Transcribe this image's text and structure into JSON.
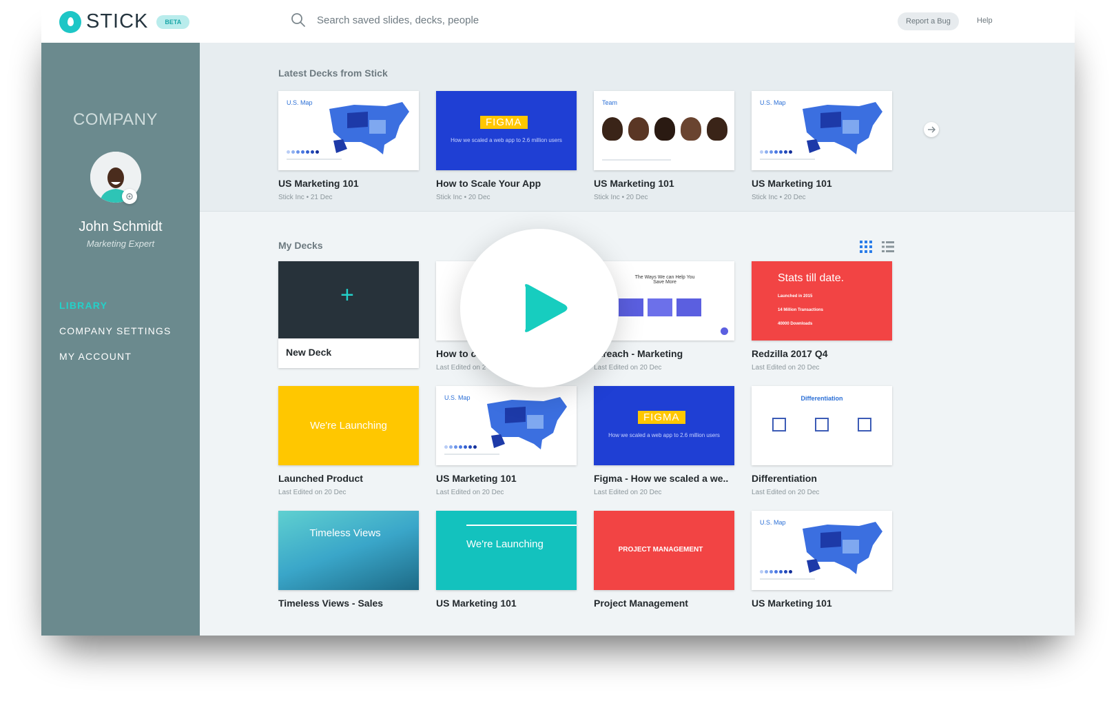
{
  "header": {
    "brand": "STICK",
    "beta": "BETA",
    "search_placeholder": "Search saved slides, decks, people",
    "report_bug": "Report a Bug",
    "help": "Help"
  },
  "sidebar": {
    "company": "COMPANY",
    "user_name": "John Schmidt",
    "user_role": "Marketing Expert",
    "nav": [
      {
        "label": "LIBRARY",
        "active": true
      },
      {
        "label": "COMPANY SETTINGS",
        "active": false
      },
      {
        "label": "MY ACCOUNT",
        "active": false
      }
    ]
  },
  "latest": {
    "title": "Latest Decks from Stick",
    "cards": [
      {
        "title": "US Marketing 101",
        "meta": "Stick Inc  •  21 Dec",
        "thumb": "map",
        "label": "U.S. Map"
      },
      {
        "title": "How to Scale Your App",
        "meta": "Stick Inc  •  20 Dec",
        "thumb": "figma",
        "label": "FIGMA",
        "caption": "How we scaled a web app to 2.6 million users"
      },
      {
        "title": "US Marketing 101",
        "meta": "Stick Inc  •  20 Dec",
        "thumb": "team",
        "label": "Team"
      },
      {
        "title": "US Marketing 101",
        "meta": "Stick Inc  •  20 Dec",
        "thumb": "map",
        "label": "U.S. Map"
      }
    ]
  },
  "my_decks": {
    "title": "My Decks",
    "new_deck": "New Deck",
    "cards": [
      {
        "title": "How to c",
        "meta": "Last Edited on 2",
        "thumb": "blank"
      },
      {
        "title": "utreach - Marketing",
        "meta": "Last Edited on 20 Dec",
        "thumb": "ways",
        "label": "The Ways We can Help You Save More"
      },
      {
        "title": "Redzilla 2017 Q4",
        "meta": "Last Edited on 20 Dec",
        "thumb": "stats",
        "label": "Stats till date.",
        "lines": [
          "Launched in 2015",
          "14 Million Transactions",
          "40000 Downloads"
        ]
      },
      {
        "title": "Launched Product",
        "meta": "Last Edited on 20 Dec",
        "thumb": "yellow",
        "label": "We're Launching"
      },
      {
        "title": "US Marketing 101",
        "meta": "Last Edited on 20 Dec",
        "thumb": "map",
        "label": "U.S. Map"
      },
      {
        "title": "Figma - How we scaled a we..",
        "meta": "Last Edited on 20 Dec",
        "thumb": "figma",
        "label": "FIGMA",
        "caption": "How we scaled a web app to 2.6 million users"
      },
      {
        "title": "Differentiation",
        "meta": "Last Edited on 20 Dec",
        "thumb": "diff",
        "label": "Differentiation"
      },
      {
        "title": "Timeless Views - Sales",
        "meta": "",
        "thumb": "timeless",
        "label": "Timeless Views"
      },
      {
        "title": "US Marketing 101",
        "meta": "",
        "thumb": "teal",
        "label": "We're Launching"
      },
      {
        "title": "Project Management",
        "meta": "",
        "thumb": "redpm",
        "label": "PROJECT MANAGEMENT"
      },
      {
        "title": "US Marketing 101",
        "meta": "",
        "thumb": "map",
        "label": "U.S. Map"
      }
    ]
  },
  "colors": {
    "accent": "#23d1c9",
    "sidebar": "#6b8a8e",
    "figma_blue": "#1f3fd4",
    "red": "#f24444",
    "yellow": "#ffc700"
  }
}
